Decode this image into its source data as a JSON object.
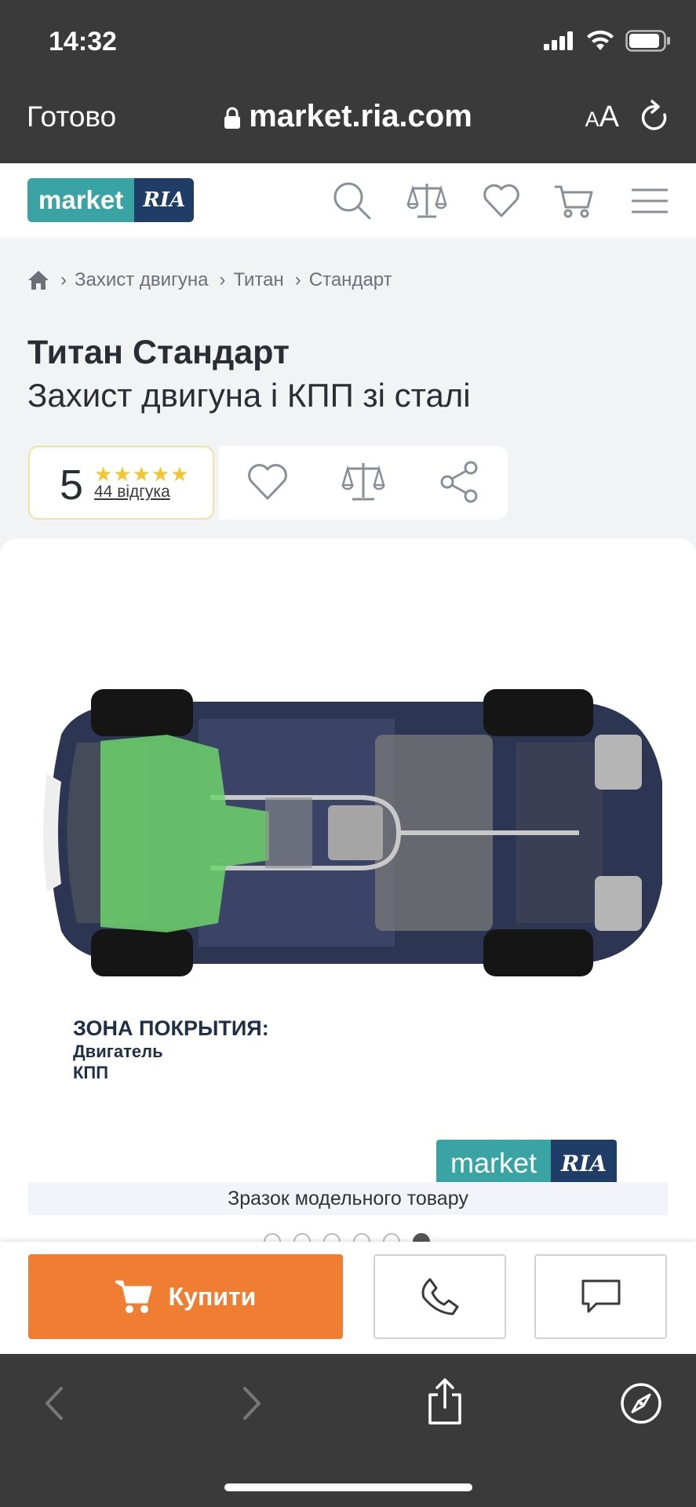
{
  "status_bar": {
    "time": "14:32"
  },
  "browser": {
    "done_label": "Готово",
    "url": "market.ria.com",
    "text_size_label_small": "A",
    "text_size_label_large": "A"
  },
  "site": {
    "logo_market": "market",
    "logo_ria": "RIA"
  },
  "breadcrumb": [
    "Захист двигуна",
    "Титан",
    "Стандарт"
  ],
  "product": {
    "title": "Титан Стандарт",
    "subtitle": "Захист двигуна і КПП зі сталі",
    "rating": "5",
    "reviews": "44 відгука",
    "stars": "★★★★★"
  },
  "image": {
    "zone_title": "ЗОНА ПОКРЫТИЯ:",
    "zone_items": [
      "Двигатель",
      "КПП"
    ],
    "logo_market": "market",
    "logo_ria": "RIA",
    "caption": "Зразок модельного товару",
    "slide_count": 6,
    "active_slide": 6
  },
  "actions": {
    "buy_label": "Купити"
  },
  "colors": {
    "accent": "#f07e32",
    "brand_teal": "#3aa3a3",
    "brand_navy": "#1f3d66",
    "chrome": "#3a3a3a"
  }
}
